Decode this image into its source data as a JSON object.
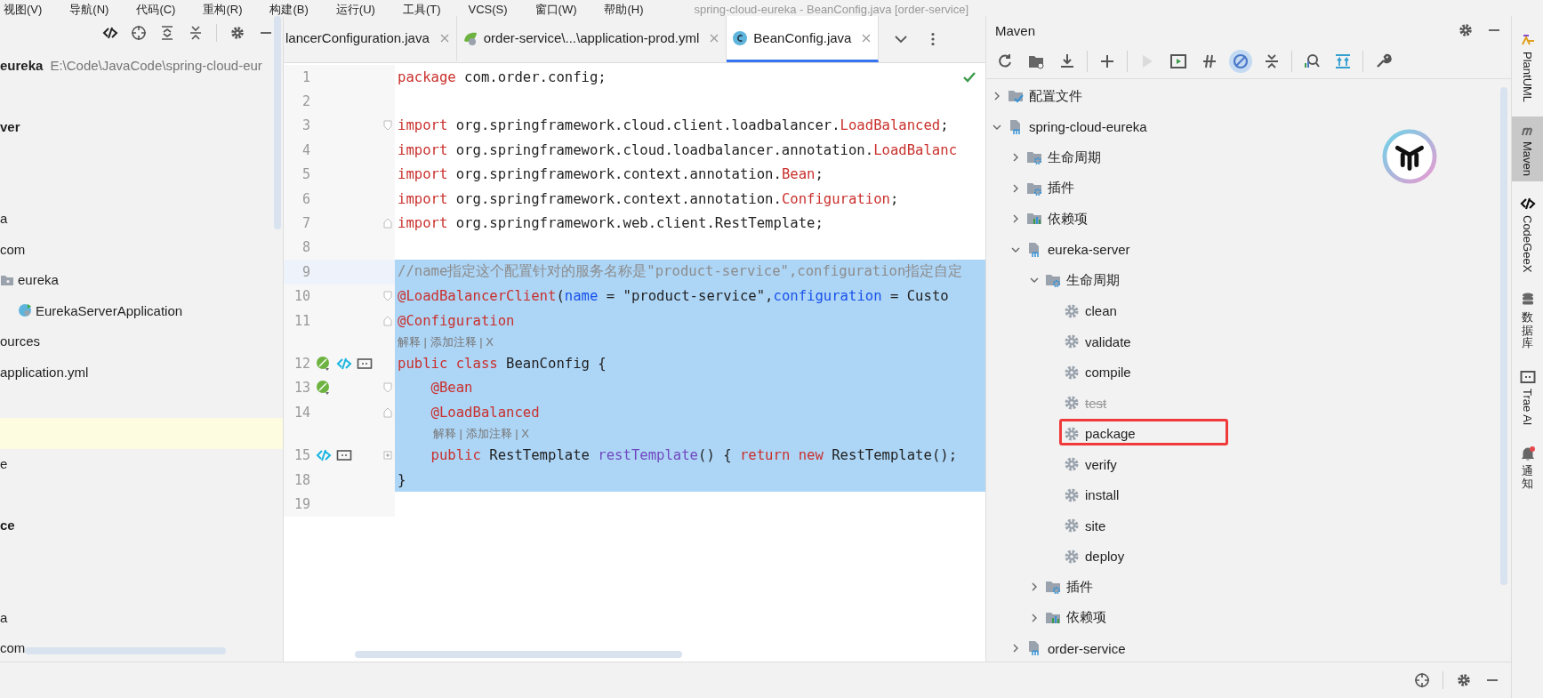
{
  "menu_bar": {
    "items": [
      "视图(V)",
      "导航(N)",
      "代码(C)",
      "重构(R)",
      "构建(B)",
      "运行(U)",
      "工具(T)",
      "VCS(S)",
      "窗口(W)",
      "帮助(H)"
    ],
    "title": "spring-cloud-eureka - BeanConfig.java [order-service]"
  },
  "project_panel": {
    "tree": [
      {
        "label": "eureka",
        "path": "E:\\Code\\JavaCode\\spring-cloud-eur",
        "bold": true
      },
      {
        "label": "ver",
        "bold": true
      },
      {
        "label": "a",
        "bold": false
      },
      {
        "label": "com",
        "bold": false,
        "children": [
          {
            "label": "eureka",
            "kind": "package",
            "bold": false,
            "children": [
              {
                "label": "EurekaServerApplication",
                "kind": "spring-class",
                "bold": false
              }
            ]
          }
        ]
      },
      {
        "label": "ources",
        "bold": false
      },
      {
        "label": "application.yml",
        "bold": false
      },
      {
        "label": "e",
        "bold": false
      },
      {
        "label": "ce",
        "bold": true
      },
      {
        "label": "a",
        "bold": false
      },
      {
        "label": "com",
        "bold": false
      }
    ]
  },
  "editor": {
    "tabs": [
      {
        "label": "lancerConfiguration.java",
        "kind": "plain",
        "selected": false
      },
      {
        "label": "order-service\\...\\application-prod.yml",
        "kind": "yml",
        "selected": false
      },
      {
        "label": "BeanConfig.java",
        "kind": "class",
        "selected": true
      }
    ],
    "lines": [
      {
        "number": "1",
        "selected": false,
        "tokens": [
          {
            "kind": "kw",
            "text": "package"
          },
          {
            "kind": "plain",
            "text": " com.order.config;"
          }
        ]
      },
      {
        "number": "2",
        "selected": false
      },
      {
        "number": "3",
        "selected": false,
        "fold": {
          "kind": "start"
        },
        "tokens": [
          {
            "kind": "kw",
            "text": "import"
          },
          {
            "kind": "plain",
            "text": " org.springframework.cloud.client.loadbalancer."
          },
          {
            "kind": "kw",
            "text": "LoadBalanced"
          },
          {
            "kind": "plain",
            "text": ";"
          }
        ]
      },
      {
        "number": "4",
        "selected": false,
        "tokens": [
          {
            "kind": "kw",
            "text": "import"
          },
          {
            "kind": "plain",
            "text": " org.springframework.cloud.loadbalancer.annotation."
          },
          {
            "kind": "kw",
            "text": "LoadBalanc"
          }
        ]
      },
      {
        "number": "5",
        "selected": false,
        "tokens": [
          {
            "kind": "kw",
            "text": "import"
          },
          {
            "kind": "plain",
            "text": " org.springframework.context.annotation."
          },
          {
            "kind": "kw",
            "text": "Bean"
          },
          {
            "kind": "plain",
            "text": ";"
          }
        ]
      },
      {
        "number": "6",
        "selected": false,
        "tokens": [
          {
            "kind": "kw",
            "text": "import"
          },
          {
            "kind": "plain",
            "text": " org.springframework.context.annotation."
          },
          {
            "kind": "kw",
            "text": "Configuration"
          },
          {
            "kind": "plain",
            "text": ";"
          }
        ]
      },
      {
        "number": "7",
        "selected": false,
        "fold": {
          "kind": "end"
        },
        "tokens": [
          {
            "kind": "kw",
            "text": "import"
          },
          {
            "kind": "plain",
            "text": " org.springframework.web.client.RestTemplate;"
          }
        ]
      },
      {
        "number": "8",
        "selected": false
      },
      {
        "number": "9",
        "selected": true,
        "tokens": [
          {
            "kind": "comment",
            "text": "//name指定这个配置针对的服务名称是\"product-service\",configuration指定自定"
          }
        ]
      },
      {
        "number": "10",
        "selected": true,
        "fold": {
          "kind": "start"
        },
        "tokens": [
          {
            "kind": "kw",
            "text": "@LoadBalancerClient"
          },
          {
            "kind": "plain",
            "text": "("
          },
          {
            "kind": "param",
            "text": "name"
          },
          {
            "kind": "plain",
            "text": " = \"product-service\","
          },
          {
            "kind": "param",
            "text": "configuration"
          },
          {
            "kind": "plain",
            "text": " = Custo"
          }
        ]
      },
      {
        "number": "11",
        "selected": true,
        "fold": {
          "kind": "end"
        },
        "tokens": [
          {
            "kind": "kw",
            "text": "@Configuration"
          }
        ]
      },
      {
        "kind": "hint",
        "selected": true,
        "text": "解释 | 添加注释 | X"
      },
      {
        "number": "12",
        "selected": true,
        "gutter_icons": [
          {
            "kind": "bean"
          },
          {
            "kind": "codegeex"
          },
          {
            "kind": "chat"
          }
        ],
        "tokens": [
          {
            "kind": "kw",
            "text": "public class"
          },
          {
            "kind": "plain",
            "text": " BeanConfig {"
          }
        ]
      },
      {
        "number": "13",
        "selected": true,
        "fold": {
          "kind": "start"
        },
        "gutter_icons": [
          {
            "kind": "bean"
          }
        ],
        "tokens": [
          {
            "kind": "kw",
            "text": "    @Bean"
          }
        ]
      },
      {
        "number": "14",
        "selected": true,
        "fold": {
          "kind": "end"
        },
        "tokens": [
          {
            "kind": "kw",
            "text": "    @LoadBalanced"
          }
        ]
      },
      {
        "kind": "hint",
        "selected": true,
        "text": "解释 | 添加注释 | X"
      },
      {
        "number": "15",
        "selected": true,
        "fold": {
          "kind": "collapsed"
        },
        "gutter_icons": [
          {
            "kind": "codegeex"
          },
          {
            "kind": "chat"
          }
        ],
        "tokens": [
          {
            "kind": "kw",
            "text": "    public"
          },
          {
            "kind": "plain",
            "text": " RestTemplate "
          },
          {
            "kind": "method",
            "text": "restTemplate"
          },
          {
            "kind": "plain",
            "text": "() { "
          },
          {
            "kind": "kw",
            "text": "return new"
          },
          {
            "kind": "plain",
            "text": " RestTemplate();"
          }
        ]
      },
      {
        "number": "18",
        "selected": true,
        "tokens": [
          {
            "kind": "plain",
            "text": "}"
          }
        ]
      },
      {
        "number": "19",
        "selected": false
      }
    ]
  },
  "maven": {
    "title": "Maven",
    "toolbar": [
      {
        "kind": "reload",
        "disabled": false,
        "selected": false
      },
      {
        "kind": "folder",
        "disabled": false,
        "selected": false
      },
      {
        "kind": "download",
        "disabled": false,
        "selected": false
      },
      {
        "kind": "sep"
      },
      {
        "kind": "plus",
        "disabled": false,
        "selected": false
      },
      {
        "kind": "sep"
      },
      {
        "kind": "run",
        "disabled": true,
        "selected": false
      },
      {
        "kind": "run-config",
        "disabled": false,
        "selected": false
      },
      {
        "kind": "offline",
        "disabled": false,
        "selected": false
      },
      {
        "kind": "skip-tests",
        "disabled": false,
        "selected": true
      },
      {
        "kind": "collapse",
        "disabled": false,
        "selected": false
      },
      {
        "kind": "sep"
      },
      {
        "kind": "analyze",
        "disabled": false,
        "selected": false
      },
      {
        "kind": "show-deps",
        "disabled": false,
        "selected": false
      },
      {
        "kind": "sep"
      },
      {
        "kind": "wrench",
        "disabled": false,
        "selected": false
      }
    ],
    "tree": [
      {
        "label": "配置文件",
        "kind": "profiles",
        "expanded": false
      },
      {
        "label": "spring-cloud-eureka",
        "kind": "project",
        "expanded": true,
        "children": [
          {
            "label": "生命周期",
            "kind": "lifecycle",
            "expanded": false
          },
          {
            "label": "插件",
            "kind": "plugins",
            "expanded": false
          },
          {
            "label": "依赖项",
            "kind": "dependencies",
            "expanded": false
          },
          {
            "label": "eureka-server",
            "kind": "project",
            "expanded": true,
            "children": [
              {
                "label": "生命周期",
                "kind": "lifecycle",
                "expanded": true,
                "children": [
                  {
                    "label": "clean",
                    "kind": "goal",
                    "disabled": false,
                    "boxed": false
                  },
                  {
                    "label": "validate",
                    "kind": "goal",
                    "disabled": false,
                    "boxed": false
                  },
                  {
                    "label": "compile",
                    "kind": "goal",
                    "disabled": false,
                    "boxed": false
                  },
                  {
                    "label": "test",
                    "kind": "goal",
                    "disabled": true,
                    "boxed": false
                  },
                  {
                    "label": "package",
                    "kind": "goal",
                    "disabled": false,
                    "boxed": true
                  },
                  {
                    "label": "verify",
                    "kind": "goal",
                    "disabled": false,
                    "boxed": false
                  },
                  {
                    "label": "install",
                    "kind": "goal",
                    "disabled": false,
                    "boxed": false
                  },
                  {
                    "label": "site",
                    "kind": "goal",
                    "disabled": false,
                    "boxed": false
                  },
                  {
                    "label": "deploy",
                    "kind": "goal",
                    "disabled": false,
                    "boxed": false
                  }
                ]
              },
              {
                "label": "插件",
                "kind": "plugins",
                "expanded": false
              },
              {
                "label": "依赖项",
                "kind": "dependencies",
                "expanded": false
              }
            ]
          },
          {
            "label": "order-service",
            "kind": "project",
            "expanded": false
          }
        ]
      }
    ]
  },
  "tool_strip": [
    {
      "label": "PlantUML",
      "kind": "plantuml",
      "selected": false
    },
    {
      "label": "Maven",
      "kind": "maven",
      "selected": true
    },
    {
      "label": "CodeGeeX",
      "kind": "codegeex",
      "selected": false
    },
    {
      "label": "数据库",
      "kind": "database",
      "selected": false
    },
    {
      "label": "Trae AI",
      "kind": "trae",
      "selected": false
    },
    {
      "label": "通知",
      "kind": "bell",
      "selected": false
    }
  ]
}
